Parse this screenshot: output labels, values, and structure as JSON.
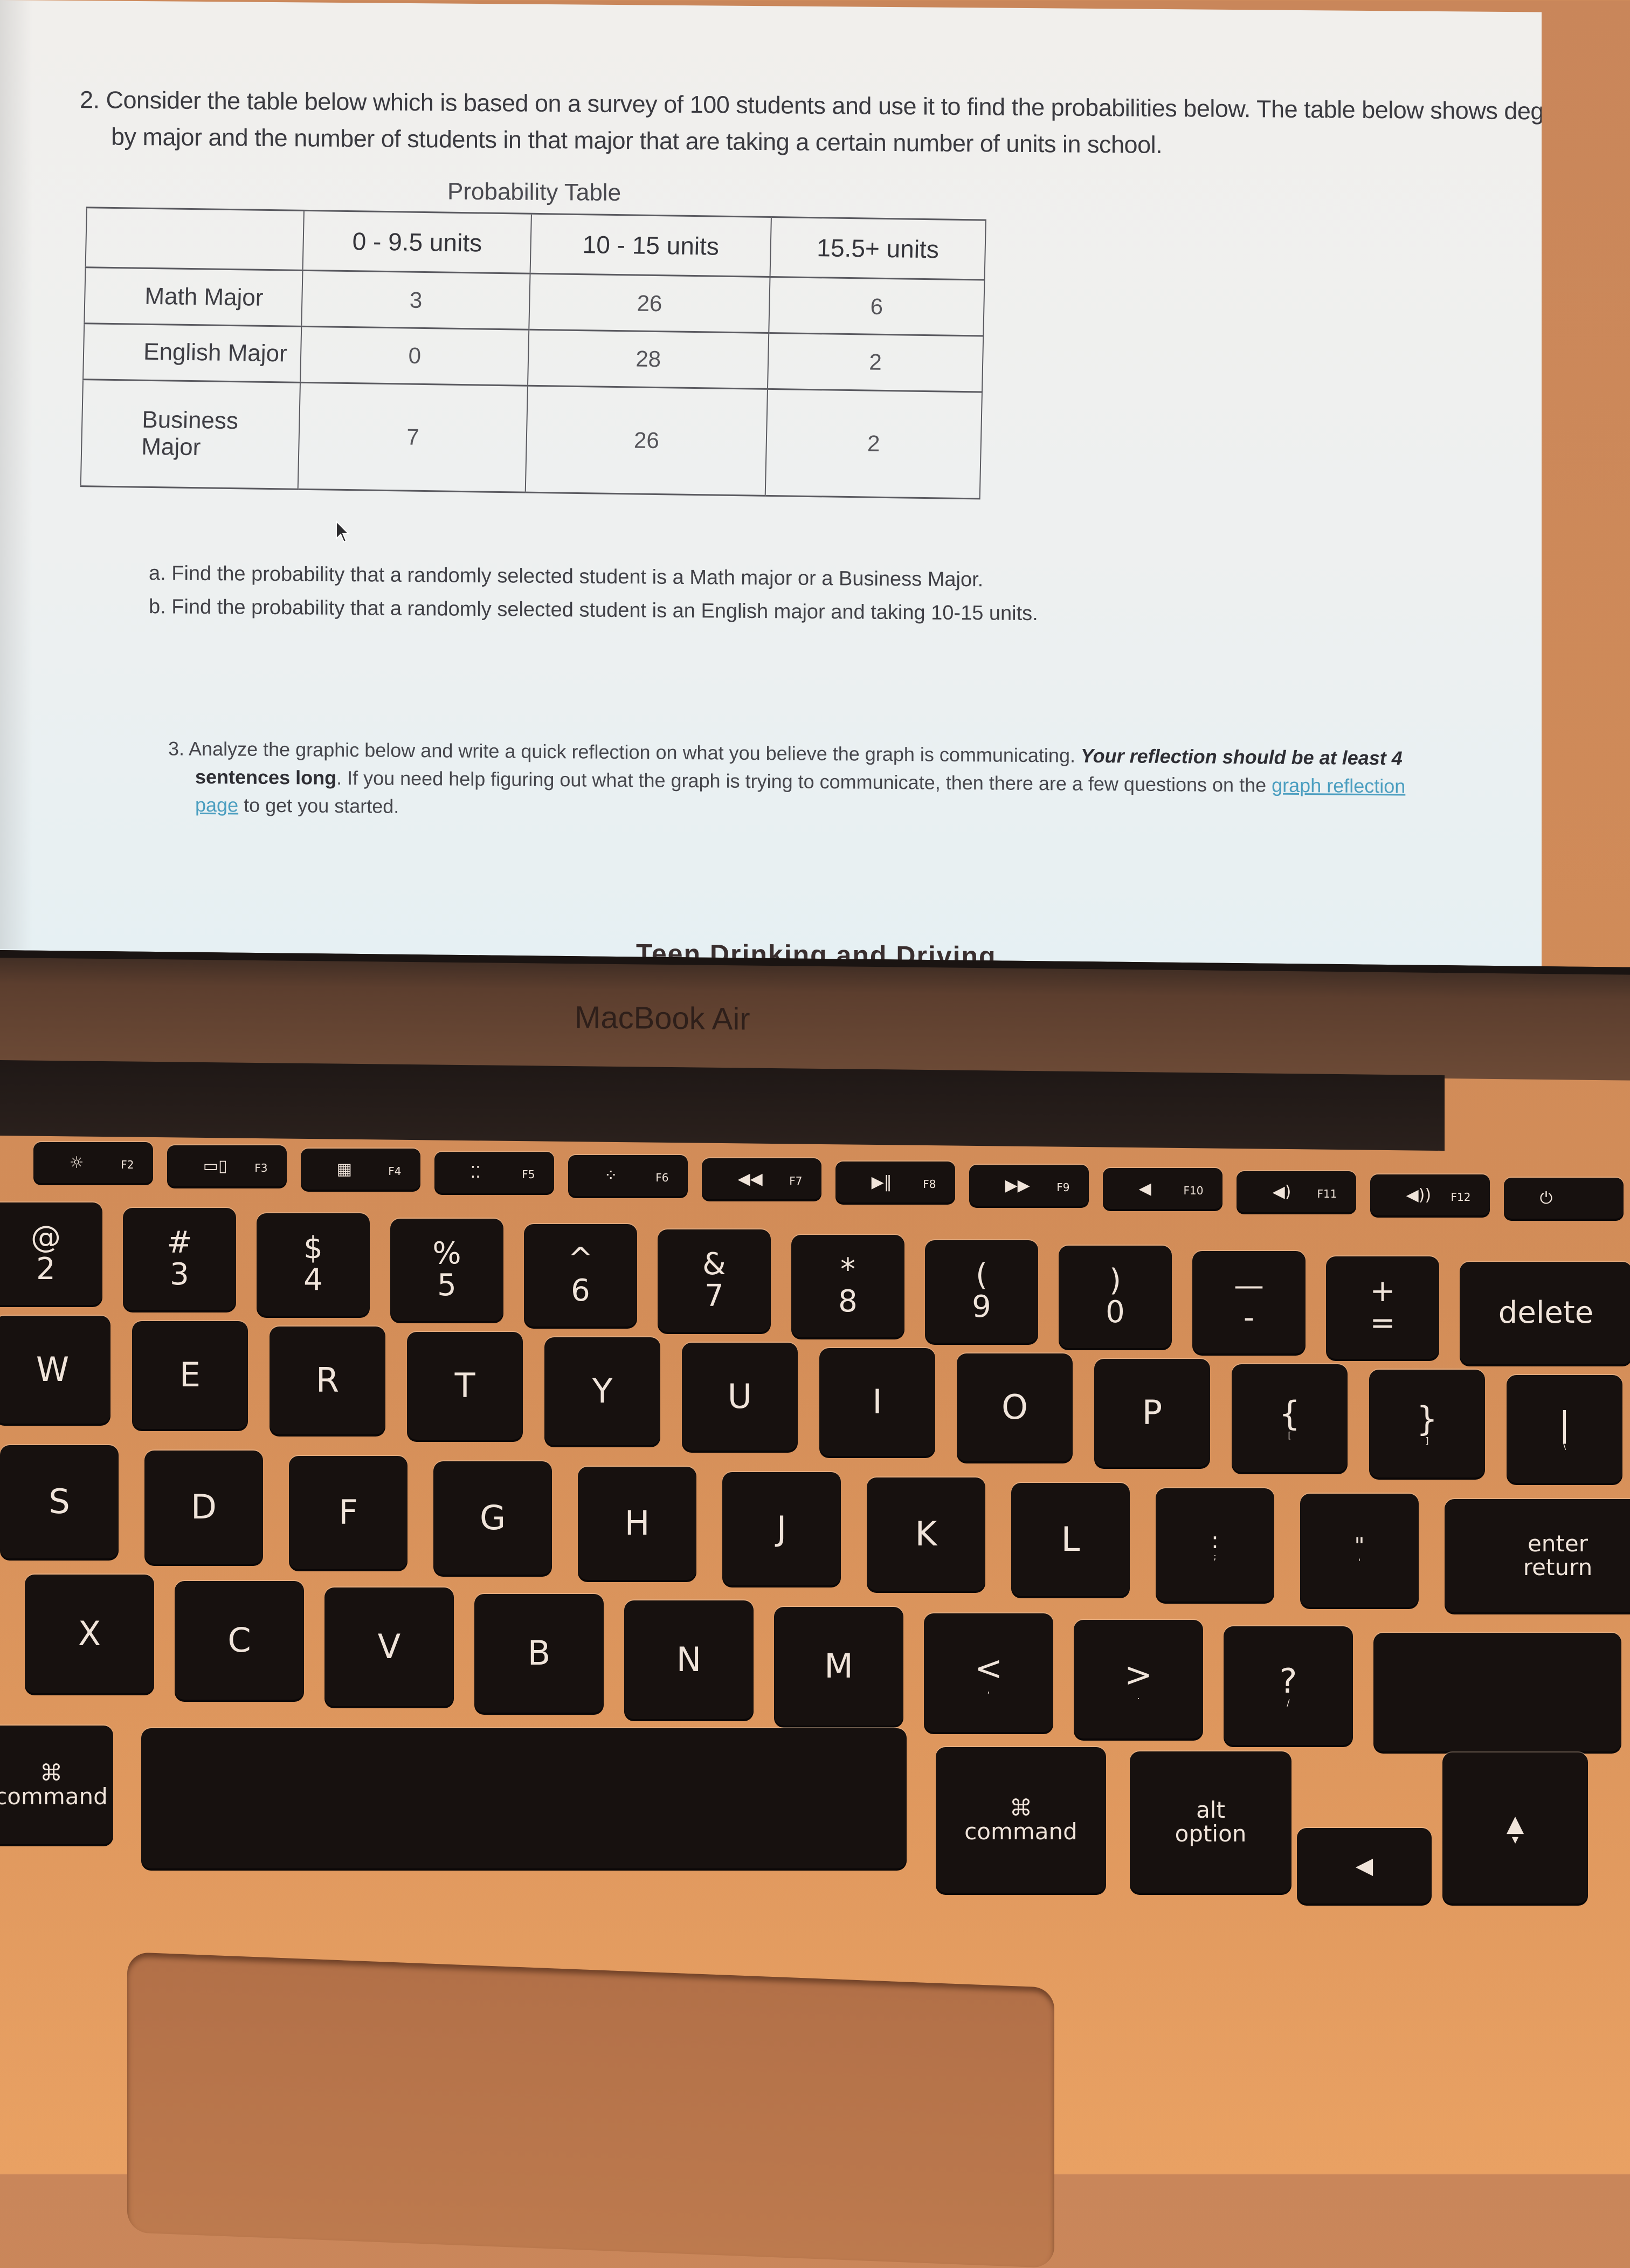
{
  "screen": {
    "question2": {
      "line1": "2. Consider the table below which is based on a survey of 100 students and use it to find the probabilities below. The table below shows degrees",
      "line2": "by major and the number of students in that major that are taking a certain number of units in school."
    },
    "table": {
      "caption": "Probability Table",
      "columns": [
        "",
        "0 - 9.5 units",
        "10 - 15 units",
        "15.5+ units"
      ],
      "rows": [
        {
          "label": "Math Major",
          "values": [
            "3",
            "26",
            "6"
          ]
        },
        {
          "label": "English Major",
          "values": [
            "0",
            "28",
            "2"
          ]
        },
        {
          "label": "Business Major",
          "values": [
            "7",
            "26",
            "2"
          ]
        }
      ]
    },
    "parts": {
      "a": "a. Find the probability that a randomly selected student is a Math major or a Business Major.",
      "b": "b. Find the probability that a randomly selected student is an English major and taking 10-15 units."
    },
    "question3": {
      "text1": "3. Analyze the graphic below and write a quick reflection on what you believe the graph is communicating.",
      "emph": "Your reflection should be at least 4",
      "bold": "sentences long",
      "text2": ".  If you need help figuring out what the graph is trying to communicate, then there are a few questions on the",
      "link1": "graph reflection",
      "link2": "page",
      "text3": "to get you started."
    },
    "graph_title_partial": "Teen Drinking and Driving"
  },
  "laptop": {
    "brand": "MacBook Air"
  },
  "keyboard": {
    "function_row": [
      {
        "glyph": "☼",
        "label": "F2"
      },
      {
        "glyph": "▭▯",
        "label": "F3"
      },
      {
        "glyph": "▦",
        "label": "F4"
      },
      {
        "glyph": "⁚⁚",
        "label": "F5"
      },
      {
        "glyph": "⁘",
        "label": "F6"
      },
      {
        "glyph": "◀◀",
        "label": "F7"
      },
      {
        "glyph": "▶‖",
        "label": "F8"
      },
      {
        "glyph": "▶▶",
        "label": "F9"
      },
      {
        "glyph": "◀",
        "label": "F10"
      },
      {
        "glyph": "◀)",
        "label": "F11"
      },
      {
        "glyph": "◀))",
        "label": "F12"
      },
      {
        "glyph": "⏻",
        "label": ""
      }
    ],
    "number_row": [
      {
        "top": "@",
        "bot": "2"
      },
      {
        "top": "#",
        "bot": "3"
      },
      {
        "top": "$",
        "bot": "4"
      },
      {
        "top": "%",
        "bot": "5"
      },
      {
        "top": "^",
        "bot": "6"
      },
      {
        "top": "&",
        "bot": "7"
      },
      {
        "top": "*",
        "bot": "8"
      },
      {
        "top": "(",
        "bot": "9"
      },
      {
        "top": ")",
        "bot": "0"
      },
      {
        "top": "—",
        "bot": "-"
      },
      {
        "top": "+",
        "bot": "="
      },
      {
        "top": "",
        "bot": "delete"
      }
    ],
    "top_row": [
      {
        "top": "W",
        "bot": ""
      },
      {
        "top": "E",
        "bot": ""
      },
      {
        "top": "R",
        "bot": ""
      },
      {
        "top": "T",
        "bot": ""
      },
      {
        "top": "Y",
        "bot": ""
      },
      {
        "top": "U",
        "bot": ""
      },
      {
        "top": "I",
        "bot": ""
      },
      {
        "top": "O",
        "bot": ""
      },
      {
        "top": "P",
        "bot": ""
      },
      {
        "top": "{",
        "bot": "["
      },
      {
        "top": "}",
        "bot": "]"
      },
      {
        "top": "|",
        "bot": "\\"
      }
    ],
    "home_row": [
      {
        "top": "S",
        "bot": ""
      },
      {
        "top": "D",
        "bot": ""
      },
      {
        "top": "F",
        "bot": ""
      },
      {
        "top": "G",
        "bot": ""
      },
      {
        "top": "H",
        "bot": ""
      },
      {
        "top": "J",
        "bot": ""
      },
      {
        "top": "K",
        "bot": ""
      },
      {
        "top": "L",
        "bot": ""
      },
      {
        "top": ":",
        "bot": ";"
      },
      {
        "top": "\"",
        "bot": "'"
      },
      {
        "top": "enter",
        "bot": "return"
      }
    ],
    "bottom_row": [
      {
        "top": "X",
        "bot": ""
      },
      {
        "top": "C",
        "bot": ""
      },
      {
        "top": "V",
        "bot": ""
      },
      {
        "top": "B",
        "bot": ""
      },
      {
        "top": "N",
        "bot": ""
      },
      {
        "top": "M",
        "bot": ""
      },
      {
        "top": "<",
        "bot": ","
      },
      {
        "top": ">",
        "bot": "."
      },
      {
        "top": "?",
        "bot": "/"
      },
      {
        "top": "",
        "bot": ""
      }
    ],
    "modifier_row": [
      {
        "top": "⌘",
        "bot": "command"
      },
      {
        "top": "",
        "bot": ""
      },
      {
        "top": "⌘",
        "bot": "command"
      },
      {
        "top": "alt",
        "bot": "option"
      },
      {
        "top": "◀",
        "bot": ""
      },
      {
        "top": "▲",
        "bot": "▼"
      }
    ]
  }
}
